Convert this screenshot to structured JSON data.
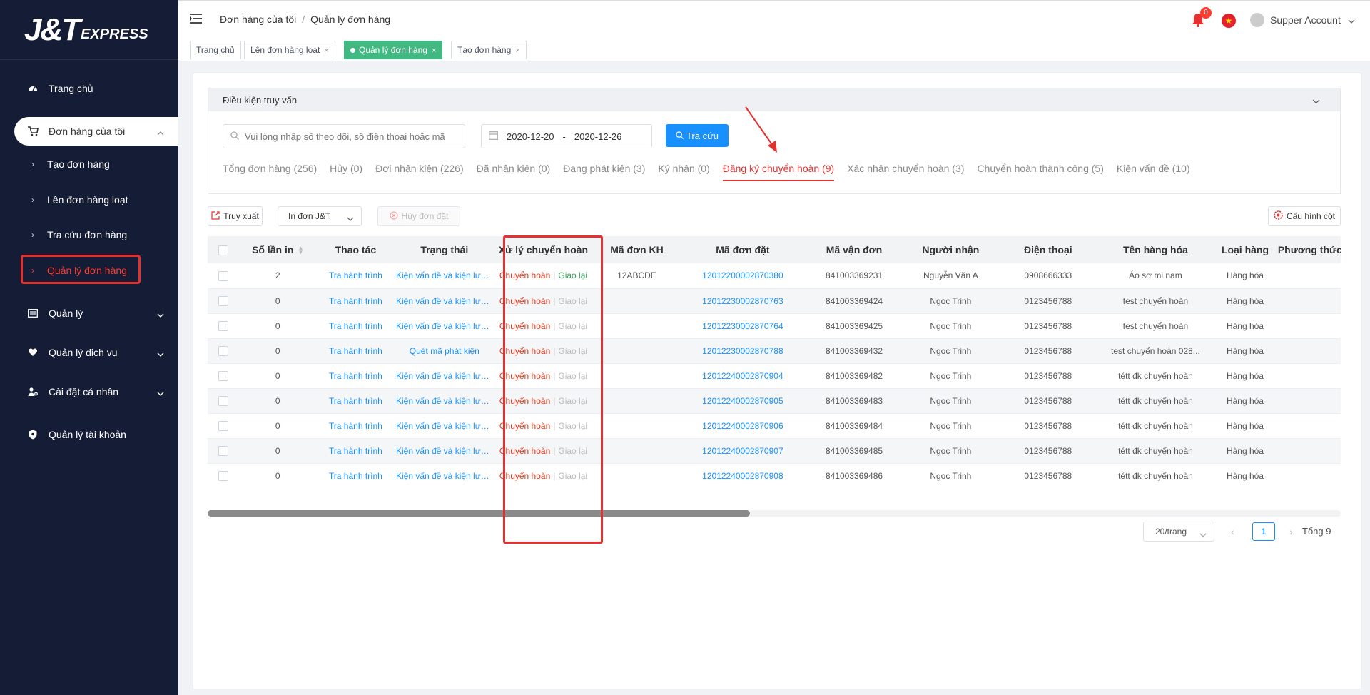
{
  "brand": {
    "logo_main": "J&T",
    "logo_sub": "EXPRESS"
  },
  "sidebar": {
    "home": "Trang chủ",
    "orders": "Đơn hàng của tôi",
    "sub_items": [
      "Tạo đơn hàng",
      "Lên đơn hàng loạt",
      "Tra cứu đơn hàng",
      "Quản lý đơn hàng"
    ],
    "manage": "Quản lý",
    "service": "Quản lý dịch vụ",
    "personal": "Cài đặt cá nhân",
    "account": "Quản lý tài khoản"
  },
  "header": {
    "breadcrumb": [
      "Đơn hàng của tôi",
      "Quản lý đơn hàng"
    ],
    "notification_count": "0",
    "user_name": "Supper Account"
  },
  "tabs": [
    "Trang chủ",
    "Lên đơn hàng loạt",
    "Quản lý đơn hàng",
    "Tạo đơn hàng"
  ],
  "query": {
    "title": "Điều kiện truy vấn",
    "search_placeholder": "Vui lòng nhập số theo dõi, số điện thoại hoặc mã",
    "date_from": "2020-12-20",
    "date_sep": "-",
    "date_to": "2020-12-26",
    "search_button": "Tra cứu"
  },
  "status_tabs": [
    "Tổng đơn hàng (256)",
    "Hủy (0)",
    "Đợi nhận kiện (226)",
    "Đã nhận kiện (0)",
    "Đang phát kiện (3)",
    "Ký nhận (0)",
    "Đăng ký chuyển hoàn (9)",
    "Xác nhận chuyển hoàn (3)",
    "Chuyển hoàn thành công (5)",
    "Kiện vấn đề (10)"
  ],
  "toolbar": {
    "export": "Truy xuất",
    "print": "In đơn J&T",
    "cancel": "Hủy đơn đặt",
    "config": "Cấu hình cột"
  },
  "table": {
    "headers": [
      "Số lần in",
      "Thao tác",
      "Trạng thái",
      "Xử lý chuyển hoàn",
      "Mã đơn KH",
      "Mã đơn đặt",
      "Mã vận đơn",
      "Người nhận",
      "Điện thoại",
      "Tên hàng hóa",
      "Loại hàng",
      "Phương thức"
    ],
    "action_label": "Tra hành trình",
    "return_label": "Chuyển hoàn",
    "deliver_label": "Giao lại",
    "rows": [
      {
        "prints": "2",
        "status": "Kiện vấn đề và kiện lưu kho",
        "cust_code": "12ABCDE",
        "order": "12012200002870380",
        "waybill": "841003369231",
        "receiver": "Nguyễn Văn A",
        "phone": "0908666333",
        "goods": "Áo sơ mi nam",
        "type": "Hàng hóa",
        "deliver_active": true
      },
      {
        "prints": "0",
        "status": "Kiện vấn đề và kiện lưu kho",
        "cust_code": "",
        "order": "12012230002870763",
        "waybill": "841003369424",
        "receiver": "Ngoc Trinh",
        "phone": "0123456788",
        "goods": "test chuyển hoàn",
        "type": "Hàng hóa",
        "deliver_active": false
      },
      {
        "prints": "0",
        "status": "Kiện vấn đề và kiện lưu kho",
        "cust_code": "",
        "order": "12012230002870764",
        "waybill": "841003369425",
        "receiver": "Ngoc Trinh",
        "phone": "0123456788",
        "goods": "test chuyển hoàn",
        "type": "Hàng hóa",
        "deliver_active": false
      },
      {
        "prints": "0",
        "status": "Quét mã phát kiện",
        "cust_code": "",
        "order": "12012230002870788",
        "waybill": "841003369432",
        "receiver": "Ngoc Trinh",
        "phone": "0123456788",
        "goods": "test chuyển hoàn 028...",
        "type": "Hàng hóa",
        "deliver_active": false
      },
      {
        "prints": "0",
        "status": "Kiện vấn đề và kiện lưu kho",
        "cust_code": "",
        "order": "12012240002870904",
        "waybill": "841003369482",
        "receiver": "Ngoc Trinh",
        "phone": "0123456788",
        "goods": "tétt đk chuyển hoàn",
        "type": "Hàng hóa",
        "deliver_active": false
      },
      {
        "prints": "0",
        "status": "Kiện vấn đề và kiện lưu kho",
        "cust_code": "",
        "order": "12012240002870905",
        "waybill": "841003369483",
        "receiver": "Ngoc Trinh",
        "phone": "0123456788",
        "goods": "tétt đk chuyển hoàn",
        "type": "Hàng hóa",
        "deliver_active": false
      },
      {
        "prints": "0",
        "status": "Kiện vấn đề và kiện lưu kho",
        "cust_code": "",
        "order": "12012240002870906",
        "waybill": "841003369484",
        "receiver": "Ngoc Trinh",
        "phone": "0123456788",
        "goods": "tétt đk chuyển hoàn",
        "type": "Hàng hóa",
        "deliver_active": false
      },
      {
        "prints": "0",
        "status": "Kiện vấn đề và kiện lưu kho",
        "cust_code": "",
        "order": "12012240002870907",
        "waybill": "841003369485",
        "receiver": "Ngoc Trinh",
        "phone": "0123456788",
        "goods": "tétt đk chuyển hoàn",
        "type": "Hàng hóa",
        "deliver_active": false
      },
      {
        "prints": "0",
        "status": "Kiện vấn đề và kiện lưu kho",
        "cust_code": "",
        "order": "12012240002870908",
        "waybill": "841003369486",
        "receiver": "Ngoc Trinh",
        "phone": "0123456788",
        "goods": "tétt đk chuyển hoàn",
        "type": "Hàng hóa",
        "deliver_active": false
      }
    ]
  },
  "pagination": {
    "page_size": "20/trang",
    "current": "1",
    "total": "Tổng 9"
  },
  "colors": {
    "accent": "#1890ff",
    "active_tab": "#42b983",
    "highlight": "#e53030",
    "sidebar": "#151c36"
  }
}
